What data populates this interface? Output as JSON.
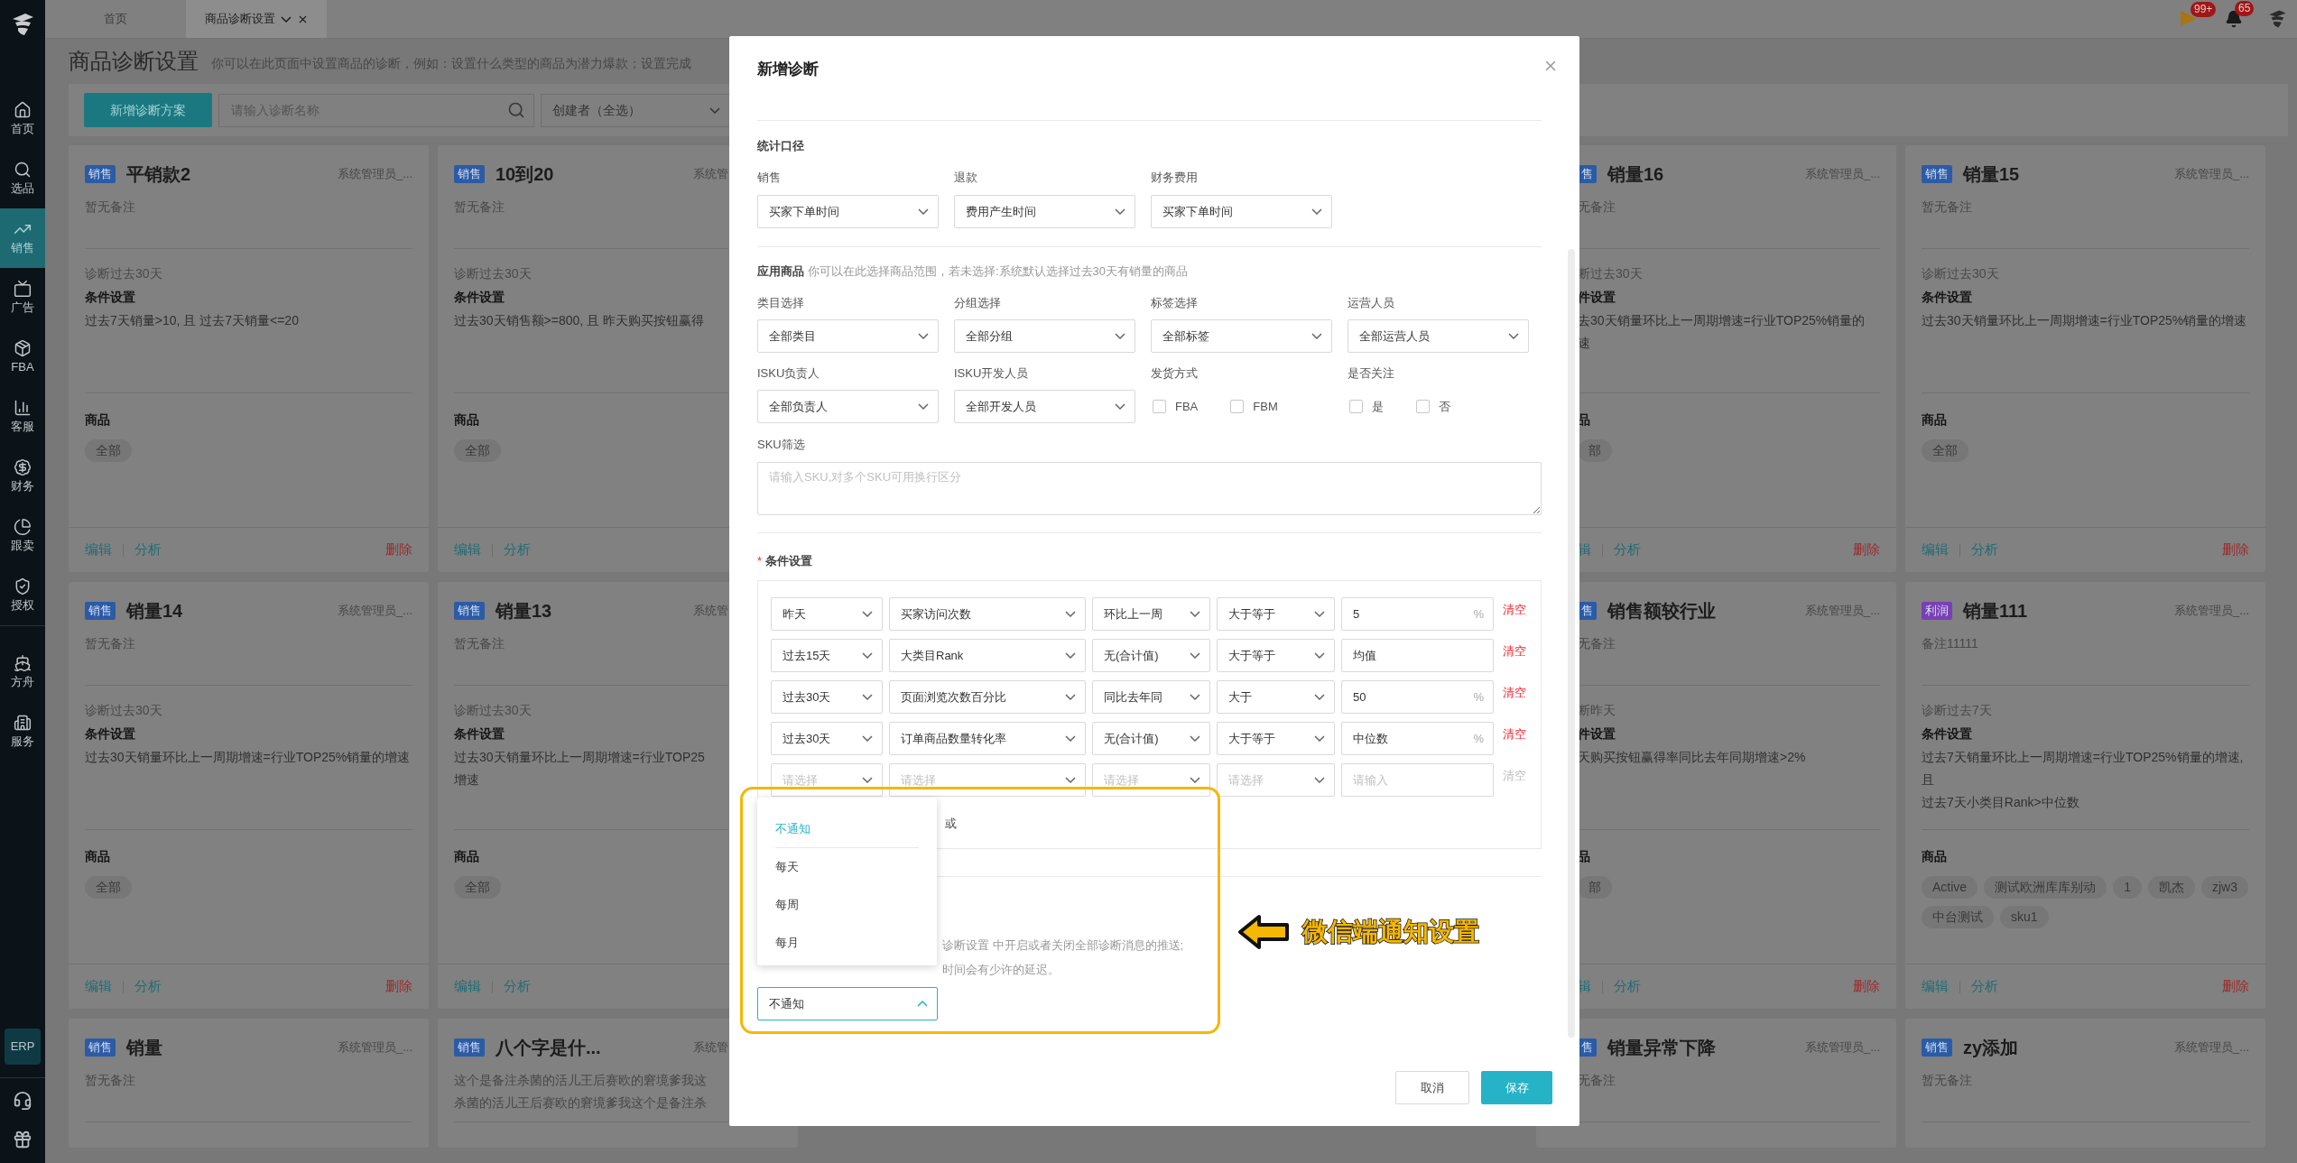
{
  "top_bar": {
    "tabs": [
      {
        "label": "首页",
        "selected": false,
        "closable": false
      },
      {
        "label": "商品诊断设置",
        "selected": true,
        "closable": true
      }
    ],
    "flag_badge": "99+",
    "bell_badge": "65"
  },
  "sidebar": {
    "groups": [
      {
        "items": [
          {
            "label": "首页",
            "selected": false
          },
          {
            "label": "选品",
            "selected": false
          },
          {
            "label": "销售",
            "selected": true
          },
          {
            "label": "广告",
            "selected": false
          },
          {
            "label": "FBA",
            "selected": false
          },
          {
            "label": "客服",
            "selected": false
          },
          {
            "label": "财务",
            "selected": false
          },
          {
            "label": "跟卖",
            "selected": false
          },
          {
            "label": "授权",
            "selected": false
          }
        ]
      },
      {
        "items": [
          {
            "label": "方舟",
            "selected": false
          },
          {
            "label": "服务",
            "selected": false
          }
        ]
      }
    ],
    "erp_label": "ERP"
  },
  "page": {
    "title": "商品诊断设置",
    "hint": "你可以在此页面中设置商品的诊断，例如：设置什么类型的商品为潜力爆款；设置完成"
  },
  "toolbar": {
    "add_button": "新增诊断方案",
    "search_placeholder": "请输入诊断名称",
    "creator_select": "创建者（全选）"
  },
  "card_columns": [
    {
      "kind": "full",
      "cards": [
        {
          "tag": "销售",
          "color": "#2c5ba6",
          "title": "平销款2",
          "owner": "系统管理员_...",
          "note": [
            "暂无备注"
          ],
          "period": "诊断过去30天",
          "condition_title": "条件设置",
          "conditions": [
            "过去7天销量>10, 且 过去7天销量<=20"
          ],
          "products_title": "商品",
          "products": [
            "全部"
          ],
          "edit": "编辑",
          "analyze": "分析",
          "delete": "删除"
        },
        {
          "tag": "销售",
          "color": "#2c5ba6",
          "title": "销量14",
          "owner": "系统管理员_...",
          "note": [
            "暂无备注"
          ],
          "period": "诊断过去30天",
          "condition_title": "条件设置",
          "conditions": [
            "过去30天销量环比上一周期增速=行业TOP25%销量的增速"
          ],
          "products_title": "商品",
          "products": [
            "全部"
          ],
          "edit": "编辑",
          "analyze": "分析",
          "delete": "删除"
        },
        {
          "tag": "销售",
          "color": "#2c5ba6",
          "title": "销量",
          "owner": "系统管理员_...",
          "note": [
            "暂无备注"
          ]
        }
      ]
    },
    {
      "kind": "cut_right",
      "cards": [
        {
          "tag": "销售",
          "color": "#2c5ba6",
          "title": "10到20",
          "owner": "系统管",
          "note": [
            "暂无备注"
          ],
          "period": "诊断过去30天",
          "condition_title": "条件设置",
          "conditions": [
            "过去30天销售额>=800, 且 昨天购买按钮赢得"
          ],
          "products_title": "商品",
          "products": [
            "全部"
          ],
          "edit": "编辑",
          "analyze": "分析"
        },
        {
          "tag": "销售",
          "color": "#2c5ba6",
          "title": "销量13",
          "owner": "系统管",
          "note": [
            "暂无备注"
          ],
          "period": "诊断过去30天",
          "condition_title": "条件设置",
          "conditions": [
            "过去30天销量环比上一周期增速=行业TOP25",
            "增速"
          ],
          "products_title": "商品",
          "products": [
            "全部"
          ],
          "edit": "编辑",
          "analyze": "分析"
        },
        {
          "tag": "销售",
          "color": "#2c5ba6",
          "title": "八个字是什...",
          "owner": "系统管",
          "note": [
            "这个是备注杀菌的活儿王后赛欧的窘境爹我这",
            "杀菌的活儿王后赛欧的窘境爹我这个是备注杀"
          ]
        }
      ]
    },
    {
      "kind": "cut_left",
      "cards": [
        {
          "tag": "售",
          "color": "#2c5ba6",
          "title": "销量16",
          "owner": "系统管理员_...",
          "note": [
            "无备注"
          ],
          "period": "断过去30天",
          "condition_title": "件设置",
          "conditions": [
            "去30天销量环比上一周期增速=行业TOP25%销量的",
            "速"
          ],
          "products_title": "品",
          "products": [
            "部"
          ],
          "edit": "辑",
          "analyze": "分析",
          "delete": "删除"
        },
        {
          "tag": "售",
          "color": "#2c5ba6",
          "title": "销售额较行业",
          "owner": "系统管理员_...",
          "note": [
            "无备注"
          ],
          "period": "断昨天",
          "condition_title": "件设置",
          "conditions": [
            "天购买按钮赢得率同比去年同期增速>2%"
          ],
          "products_title": "品",
          "products": [
            "部"
          ],
          "edit": "辑",
          "analyze": "分析",
          "delete": "删除"
        },
        {
          "tag": "售",
          "color": "#2c5ba6",
          "title": "销量异常下降",
          "owner": "系统管理员_...",
          "note": [
            "无备注"
          ]
        }
      ]
    },
    {
      "kind": "full",
      "cards": [
        {
          "tag": "销售",
          "color": "#2c5ba6",
          "title": "销量15",
          "owner": "系统管理员_...",
          "note": [
            "暂无备注"
          ],
          "period": "诊断过去30天",
          "condition_title": "条件设置",
          "conditions": [
            "过去30天销量环比上一周期增速=行业TOP25%销量的增速"
          ],
          "products_title": "商品",
          "products": [
            "全部"
          ],
          "edit": "编辑",
          "analyze": "分析",
          "delete": "删除"
        },
        {
          "tag": "利润",
          "color": "#7b3fb5",
          "title": "销量111",
          "owner": "系统管理员_...",
          "note": [
            "备注11111"
          ],
          "period": "诊断过去7天",
          "condition_title": "条件设置",
          "conditions": [
            "过去7天销量环比上一周期增速=行业TOP25%销量的增速, 且",
            "过去7天小类目Rank>中位数"
          ],
          "products_title": "商品",
          "products": [
            "Active",
            "测试欧洲库库别动",
            "1",
            "凯杰",
            "zjw3",
            "中台测试",
            "sku1"
          ],
          "edit": "编辑",
          "analyze": "分析",
          "delete": "删除"
        },
        {
          "tag": "销售",
          "color": "#2c5ba6",
          "title": "zy添加",
          "owner": "系统管理员_...",
          "note": [
            "暂无备注"
          ]
        }
      ]
    }
  ],
  "modal": {
    "title": "新增诊断",
    "stats": {
      "title": "统计口径",
      "fields": [
        {
          "label": "销售",
          "value": "买家下单时间"
        },
        {
          "label": "退款",
          "value": "费用产生时间"
        },
        {
          "label": "财务费用",
          "value": "买家下单时间"
        }
      ]
    },
    "products": {
      "title": "应用商品",
      "hint": "你可以在此选择商品范围，若未选择:系统默认选择过去30天有销量的商品",
      "fields": [
        {
          "kind": "select",
          "label": "类目选择",
          "value": "全部类目"
        },
        {
          "kind": "select",
          "label": "分组选择",
          "value": "全部分组"
        },
        {
          "kind": "select",
          "label": "标签选择",
          "value": "全部标签"
        },
        {
          "kind": "select",
          "label": "运营人员",
          "value": "全部运营人员"
        },
        {
          "kind": "select",
          "label": "ISKU负责人",
          "value": "全部负责人"
        },
        {
          "kind": "select",
          "label": "ISKU开发人员",
          "value": "全部开发人员"
        },
        {
          "kind": "checks",
          "label": "发货方式",
          "options": [
            {
              "label": "FBA",
              "checked": false
            },
            {
              "label": "FBM",
              "checked": false
            }
          ]
        },
        {
          "kind": "checks",
          "label": "是否关注",
          "options": [
            {
              "label": "是",
              "checked": false
            },
            {
              "label": "否",
              "checked": false
            }
          ]
        }
      ],
      "sku_label": "SKU筛选",
      "sku_placeholder": "请输入SKU,对多个SKU可用换行区分"
    },
    "conditions": {
      "title": "条件设置",
      "required_mark": "*",
      "or_label": "或",
      "rows": [
        {
          "cells": [
            {
              "value": "昨天"
            },
            {
              "value": "买家访问次数"
            },
            {
              "value": "环比上一周"
            },
            {
              "value": "大于等于"
            },
            {
              "value": "5"
            }
          ],
          "unit": "%",
          "clear": "清空",
          "clear_enabled": true
        },
        {
          "cells": [
            {
              "value": "过去15天"
            },
            {
              "value": "大类目Rank"
            },
            {
              "value": "无(合计值)"
            },
            {
              "value": "大于等于"
            },
            {
              "value": "均值"
            }
          ],
          "clear": "清空",
          "clear_enabled": true
        },
        {
          "cells": [
            {
              "value": "过去30天"
            },
            {
              "value": "页面浏览次数百分比"
            },
            {
              "value": "同比去年同"
            },
            {
              "value": "大于"
            },
            {
              "value": "50"
            }
          ],
          "unit": "%",
          "clear": "清空",
          "clear_enabled": true
        },
        {
          "cells": [
            {
              "value": "过去30天"
            },
            {
              "value": "订单商品数量转化率"
            },
            {
              "value": "无(合计值)"
            },
            {
              "value": "大于等于"
            },
            {
              "value": "中位数"
            }
          ],
          "unit": "%",
          "clear": "清空",
          "clear_enabled": true
        },
        {
          "cells": [
            {
              "placeholder": "请选择"
            },
            {
              "placeholder": "请选择"
            },
            {
              "placeholder": "请选择"
            },
            {
              "placeholder": "请选择"
            },
            {
              "placeholder": "请输入"
            }
          ],
          "clear": "清空",
          "clear_enabled": false
        }
      ]
    },
    "notify": {
      "hint_lines": [
        "诊断设置 中开启或者关闭全部诊断消息的推送;",
        "时间会有少许的延迟。"
      ],
      "value": "不通知",
      "expanded": true,
      "options": [
        {
          "label": "不通知",
          "selected": true
        },
        {
          "label": "每天",
          "selected": false
        },
        {
          "label": "每周",
          "selected": false
        },
        {
          "label": "每月",
          "selected": false
        }
      ]
    },
    "cancel": "取消",
    "save": "保存"
  },
  "annotation": {
    "label": "微信端通知设置"
  }
}
